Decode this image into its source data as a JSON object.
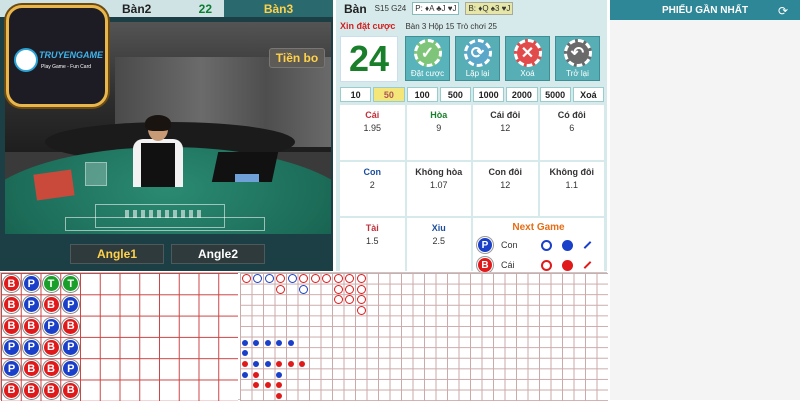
{
  "tabs": {
    "tab1": "Bàn",
    "tab2": "Bàn2",
    "tab2_count": "22",
    "tab3": "Bàn3"
  },
  "video": {
    "tien_bo": "Tiền bo",
    "angle1": "Angle1",
    "angle2": "Angle2"
  },
  "logo": {
    "brand": "TRUYENGAME",
    "slogan": "Play Game - Fun Card"
  },
  "bet": {
    "table_label": "Bàn",
    "shoe_info": "S15 G24",
    "p_cards": "P: ♦A ♣J ♥J",
    "b_cards": "B: ♦Q ♠3 ♥J",
    "prompt": "Xin đặt cược",
    "table_info": "Bàn 3   Hộp 15   Trò chơi 25",
    "timer": "24",
    "actions": [
      {
        "icon": "✓",
        "label": "Đặt cược"
      },
      {
        "icon": "⟳",
        "label": "Lặp lại"
      },
      {
        "icon": "✕",
        "label": "Xoá"
      },
      {
        "icon": "↶",
        "label": "Trở lại"
      }
    ],
    "chips": [
      "10",
      "50",
      "100",
      "500",
      "1000",
      "2000",
      "5000",
      "Xoá"
    ],
    "selected_chip": "50",
    "cells": [
      {
        "name": "Cái",
        "odds": "1.95",
        "color": "red"
      },
      {
        "name": "Hòa",
        "odds": "9",
        "color": "green"
      },
      {
        "name": "Cái đôi",
        "odds": "12",
        "color": "dark"
      },
      {
        "name": "Có đôi",
        "odds": "6",
        "color": "dark"
      },
      {
        "name": "Con",
        "odds": "2",
        "color": "blue"
      },
      {
        "name": "Không hòa",
        "odds": "1.07",
        "color": "dark"
      },
      {
        "name": "Con đôi",
        "odds": "12",
        "color": "dark"
      },
      {
        "name": "Không đôi",
        "odds": "1.1",
        "color": "dark"
      },
      {
        "name": "Tài",
        "odds": "1.5",
        "color": "red"
      },
      {
        "name": "Xỉu",
        "odds": "2.5",
        "color": "blue"
      }
    ],
    "next_game": {
      "title": "Next Game",
      "rows": [
        {
          "badge": "P",
          "label": "Con",
          "color": "#1a3fc9"
        },
        {
          "badge": "B",
          "label": "Cái",
          "color": "#e01a1a"
        }
      ]
    }
  },
  "right": {
    "title": "PHIẾU GẦN NHẤT",
    "refresh_icon": "refresh-icon"
  },
  "bead_road": [
    [
      "B",
      "P",
      "T",
      "T"
    ],
    [
      "B",
      "P",
      "B",
      "P"
    ],
    [
      "B",
      "B",
      "P",
      "B"
    ],
    [
      "P",
      "P",
      "B",
      "P"
    ],
    [
      "P",
      "B",
      "B",
      "P"
    ],
    [
      "B",
      "B",
      "B",
      "B"
    ]
  ],
  "colors": {
    "banker": "#e01a1a",
    "player": "#1a3fc9",
    "tie": "#1aa02a",
    "accent": "#2e8796"
  }
}
